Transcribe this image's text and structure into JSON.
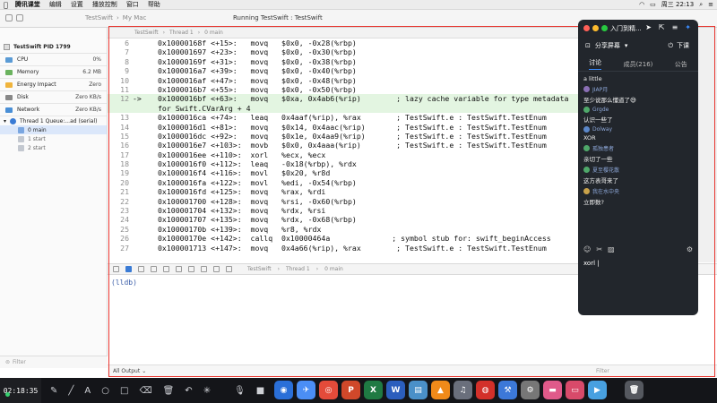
{
  "menubar": {
    "apple": "",
    "app": "腾讯课堂",
    "items": [
      "编辑",
      "设置",
      "播放控制",
      "窗口",
      "帮助"
    ],
    "clock": "周三 22:13"
  },
  "toolbar": {
    "scheme": "TestSwift",
    "device": "My Mac",
    "status": "Running TestSwift : TestSwift"
  },
  "debug_nav": {
    "process": "TestSwift PID 1799",
    "gauges": [
      {
        "label": "CPU",
        "value": "0%",
        "color": "#5a9bd5"
      },
      {
        "label": "Memory",
        "value": "6.2 MB",
        "color": "#6bb35f"
      },
      {
        "label": "Energy Impact",
        "value": "Zero",
        "color": "#f0b43c"
      },
      {
        "label": "Disk",
        "value": "Zero KB/s",
        "color": "#888888"
      },
      {
        "label": "Network",
        "value": "Zero KB/s",
        "color": "#4a8fd6"
      }
    ],
    "thread": "Thread 1 Queue:...ad (serial)",
    "frames": [
      {
        "label": "0 main",
        "selected": true
      },
      {
        "label": "1 start",
        "selected": false
      },
      {
        "label": "2 start",
        "selected": false
      }
    ],
    "filter_placeholder": "Filter"
  },
  "jumpbar": [
    "TestSwift",
    "Thread 1",
    "0 main"
  ],
  "code_lines": [
    {
      "n": "6",
      "t": "0x10000168f <+15>:   movq   $0x0, -0x28(%rbp)",
      "hl": false
    },
    {
      "n": "7",
      "t": "0x100001697 <+23>:   movq   $0x0, -0x30(%rbp)",
      "hl": false
    },
    {
      "n": "8",
      "t": "0x10000169f <+31>:   movq   $0x0, -0x38(%rbp)",
      "hl": false
    },
    {
      "n": "9",
      "t": "0x1000016a7 <+39>:   movq   $0x0, -0x40(%rbp)",
      "hl": false
    },
    {
      "n": "10",
      "t": "0x1000016af <+47>:   movq   $0x0, -0x48(%rbp)",
      "hl": false
    },
    {
      "n": "11",
      "t": "0x1000016b7 <+55>:   movq   $0x0, -0x50(%rbp)",
      "hl": false
    },
    {
      "n": "12",
      "t": "0x1000016bf <+63>:   movq   $0xa, 0x4ab6(%rip)        ; lazy cache variable for type metadata",
      "hl": true,
      "arrow": "->"
    },
    {
      "n": "",
      "t": "for Swift.CVarArg + 4",
      "hl": true
    },
    {
      "n": "13",
      "t": "0x1000016ca <+74>:   leaq   0x4aaf(%rip), %rax        ; TestSwift.e : TestSwift.TestEnum",
      "hl": false
    },
    {
      "n": "14",
      "t": "0x1000016d1 <+81>:   movq   $0x14, 0x4aac(%rip)       ; TestSwift.e : TestSwift.TestEnum",
      "hl": false
    },
    {
      "n": "15",
      "t": "0x1000016dc <+92>:   movq   $0x1e, 0x4aa9(%rip)       ; TestSwift.e : TestSwift.TestEnum",
      "hl": false
    },
    {
      "n": "16",
      "t": "0x1000016e7 <+103>:  movb   $0x0, 0x4aaa(%rip)        ; TestSwift.e : TestSwift.TestEnum",
      "hl": false
    },
    {
      "n": "17",
      "t": "0x1000016ee <+110>:  xorl   %ecx, %ecx",
      "hl": false
    },
    {
      "n": "18",
      "t": "0x1000016f0 <+112>:  leaq   -0x18(%rbp), %rdx",
      "hl": false
    },
    {
      "n": "19",
      "t": "0x1000016f4 <+116>:  movl   $0x20, %r8d",
      "hl": false
    },
    {
      "n": "20",
      "t": "0x1000016fa <+122>:  movl   %edi, -0x54(%rbp)",
      "hl": false
    },
    {
      "n": "21",
      "t": "0x1000016fd <+125>:  movq   %rax, %rdi",
      "hl": false
    },
    {
      "n": "22",
      "t": "0x100001700 <+128>:  movq   %rsi, -0x60(%rbp)",
      "hl": false
    },
    {
      "n": "23",
      "t": "0x100001704 <+132>:  movq   %rdx, %rsi",
      "hl": false
    },
    {
      "n": "24",
      "t": "0x100001707 <+135>:  movq   %rdx, -0x68(%rbp)",
      "hl": false
    },
    {
      "n": "25",
      "t": "0x10000170b <+139>:  movq   %r8, %rdx",
      "hl": false
    },
    {
      "n": "26",
      "t": "0x10000170e <+142>:  callq  0x10000464a              ; symbol stub for: swift_beginAccess",
      "hl": false
    },
    {
      "n": "27",
      "t": "0x100001713 <+147>:  movq   0x4a66(%rip), %rax        ; TestSwift.e : TestSwift.TestEnum",
      "hl": false
    }
  ],
  "debugbar_crumbs": [
    "TestSwift",
    "Thread 1",
    "0 main"
  ],
  "console": {
    "prompt": "(lldb)",
    "output_label": "All Output",
    "filter_placeholder": "Filter"
  },
  "taskbar": {
    "time": "02:18:35"
  },
  "chat": {
    "title": "入门到精...",
    "share_label": "分享屏幕",
    "down_label": "下课",
    "tabs": [
      {
        "label": "讨论",
        "active": true
      },
      {
        "label": "成员(216)",
        "active": false
      },
      {
        "label": "公告",
        "active": false
      }
    ],
    "messages": [
      {
        "user": "",
        "text": "a little"
      },
      {
        "user": "JIAP月",
        "text": "至少说那么懂道了😅"
      },
      {
        "user": "Grgde",
        "text": "认识一些了"
      },
      {
        "user": "Dolway",
        "text": "XOR"
      },
      {
        "user": "孤独患者",
        "text": "亲切了一些"
      },
      {
        "user": "夏至樱花散",
        "text": "这方表哥来了"
      },
      {
        "user": "我在水中央",
        "text": "立即数?"
      }
    ],
    "input": "xorl"
  },
  "colors": {
    "accent": "#3a8cff",
    "capture_border": "#e8342e",
    "highlight_line": "#e3f5e1"
  }
}
